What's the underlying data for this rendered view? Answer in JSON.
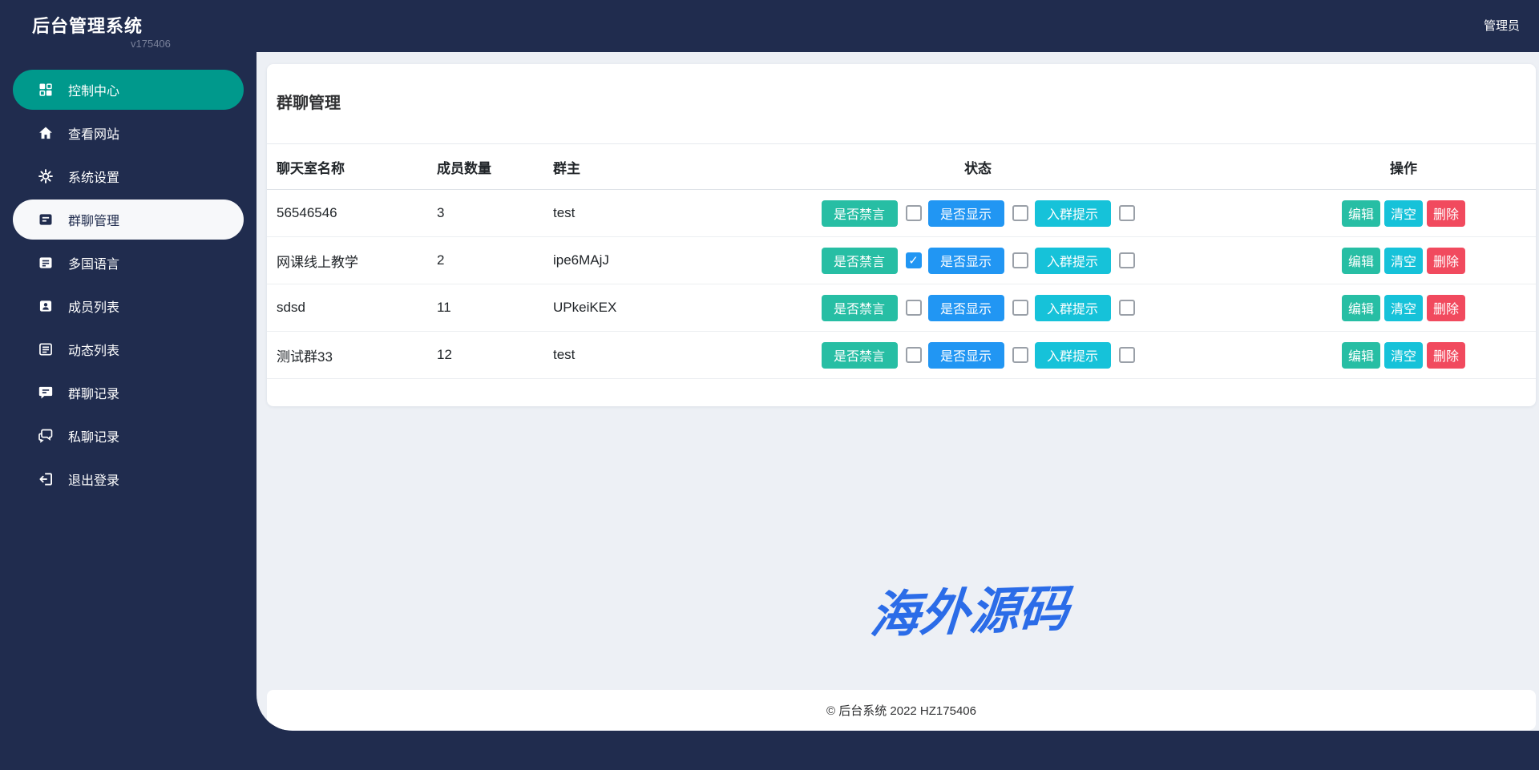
{
  "app": {
    "title": "后台管理系统",
    "version": "v175406"
  },
  "topbar": {
    "user": "管理员"
  },
  "sidebar": {
    "items": [
      {
        "label": "控制中心",
        "icon": "dashboard-icon",
        "state": "highlight"
      },
      {
        "label": "查看网站",
        "icon": "home-icon",
        "state": "normal"
      },
      {
        "label": "系统设置",
        "icon": "gear-icon",
        "state": "normal"
      },
      {
        "label": "群聊管理",
        "icon": "group-chat-icon",
        "state": "active"
      },
      {
        "label": "多国语言",
        "icon": "language-icon",
        "state": "normal"
      },
      {
        "label": "成员列表",
        "icon": "members-icon",
        "state": "normal"
      },
      {
        "label": "动态列表",
        "icon": "feed-list-icon",
        "state": "normal"
      },
      {
        "label": "群聊记录",
        "icon": "group-log-icon",
        "state": "normal"
      },
      {
        "label": "私聊记录",
        "icon": "private-log-icon",
        "state": "normal"
      },
      {
        "label": "退出登录",
        "icon": "logout-icon",
        "state": "normal"
      }
    ]
  },
  "page": {
    "title": "群聊管理"
  },
  "table": {
    "headers": {
      "name": "聊天室名称",
      "members": "成员数量",
      "owner": "群主",
      "status": "状态",
      "actions": "操作"
    },
    "labels": {
      "mute": "是否禁言",
      "visible": "是否显示",
      "join_tip": "入群提示",
      "edit": "编辑",
      "clear": "清空",
      "delete": "删除"
    },
    "rows": [
      {
        "name": "56546546",
        "members": "3",
        "owner": "test",
        "checks": {
          "mute": false,
          "visible": false,
          "join_tip": false
        }
      },
      {
        "name": "网课线上教学",
        "members": "2",
        "owner": "ipe6MAjJ",
        "checks": {
          "mute": true,
          "visible": false,
          "join_tip": false
        }
      },
      {
        "name": "sdsd",
        "members": "11",
        "owner": "UPkeiKEX",
        "checks": {
          "mute": false,
          "visible": false,
          "join_tip": false
        }
      },
      {
        "name": "测试群33",
        "members": "12",
        "owner": "test",
        "checks": {
          "mute": false,
          "visible": false,
          "join_tip": false
        }
      }
    ]
  },
  "watermark": {
    "text": "海外源码"
  },
  "footer": {
    "text": "© 后台系统 2022 HZ175406"
  },
  "colors": {
    "navy": "#202c4e",
    "teal_dark": "#00998c",
    "teal": "#27bea4",
    "blue": "#2196f3",
    "cyan": "#16c2d9",
    "red": "#f14a5e",
    "bg_gray": "#edf0f5",
    "watermark_blue": "#2b6ce8"
  }
}
